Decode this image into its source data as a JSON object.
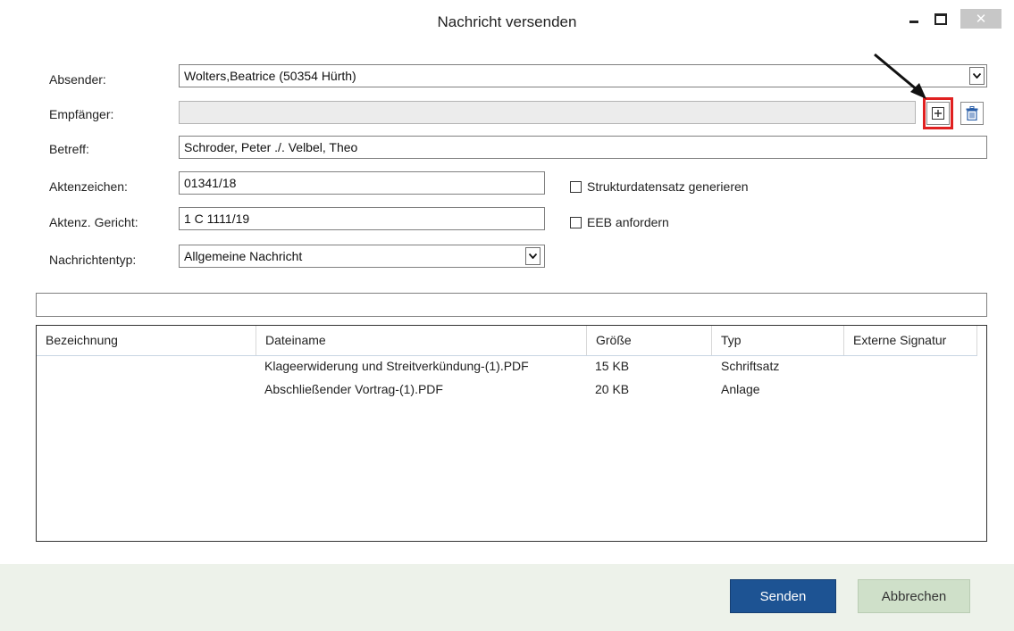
{
  "window": {
    "title": "Nachricht versenden",
    "close_glyph": "✕"
  },
  "form": {
    "absender_label": "Absender:",
    "absender_value": "Wolters,Beatrice (50354 Hürth)",
    "empfaenger_label": "Empfänger:",
    "empfaenger_value": "",
    "betreff_label": "Betreff:",
    "betreff_value": "Schroder, Peter ./. Velbel, Theo",
    "aktenzeichen_label": "Aktenzeichen:",
    "aktenzeichen_value": "01341/18",
    "aktenz_gericht_label": "Aktenz. Gericht:",
    "aktenz_gericht_value": "1 C 1111/19",
    "nachrichtentyp_label": "Nachrichtentyp:",
    "nachrichtentyp_value": "Allgemeine Nachricht",
    "strukturdatensatz_label": "Strukturdatensatz generieren",
    "strukturdatensatz_checked": false,
    "eeb_label": "EEB anfordern",
    "eeb_checked": false,
    "info_bar_value": ""
  },
  "icons": {
    "add_recipient": "plus-square-icon",
    "delete_recipient": "trash-icon",
    "dropdown": "chevron-down-icon",
    "annotation_arrow": "arrow-icon"
  },
  "table": {
    "columns": [
      "Bezeichnung",
      "Dateiname",
      "Größe",
      "Typ",
      "Externe Signatur"
    ],
    "rows": [
      {
        "bezeichnung": "",
        "dateiname": "Klageerwiderung und Streitverkündung-(1).PDF",
        "groesse": "15 KB",
        "typ": "Schriftsatz",
        "signatur": ""
      },
      {
        "bezeichnung": "",
        "dateiname": "Abschließender Vortrag-(1).PDF",
        "groesse": "20 KB",
        "typ": "Anlage",
        "signatur": ""
      }
    ]
  },
  "footer": {
    "send_label": "Senden",
    "cancel_label": "Abbrechen"
  },
  "colors": {
    "send_button": "#1d5393",
    "cancel_button": "#cfe0c9",
    "footer_bg": "#edf2ea",
    "highlight": "#e02020",
    "trash_icon": "#2a5ea8"
  }
}
